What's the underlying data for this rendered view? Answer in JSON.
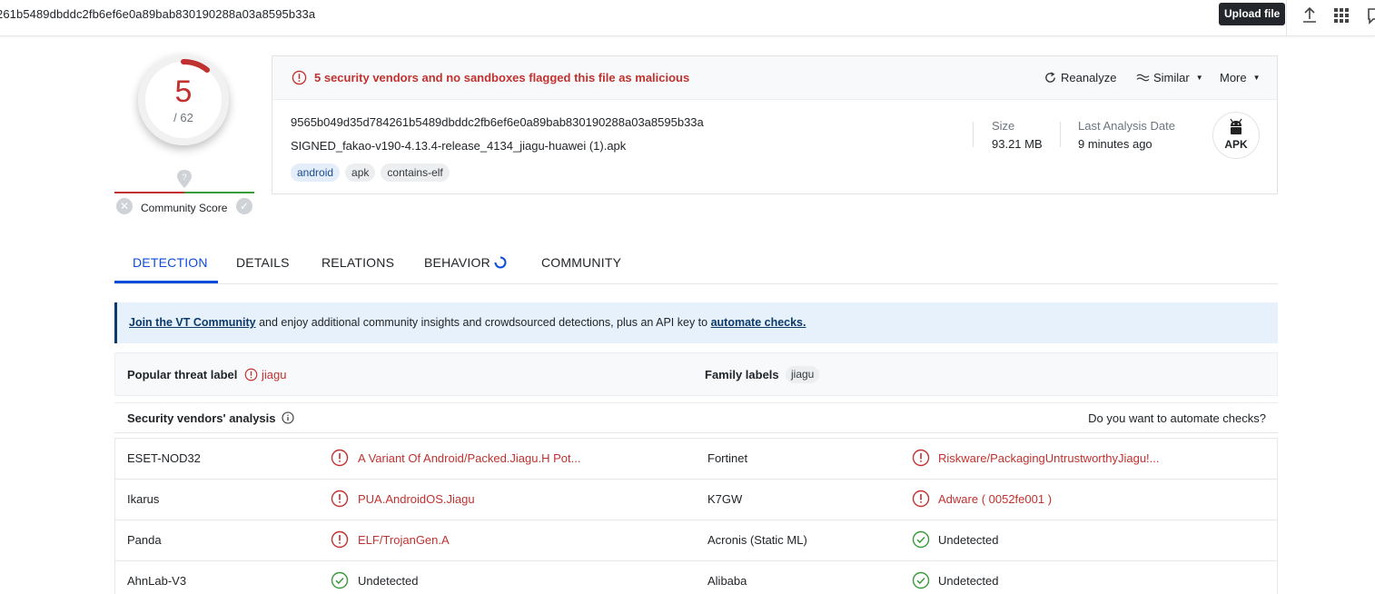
{
  "topbar": {
    "hash_text": "261b5489dbddc2fb6ef6e0a89bab830190288a03a8595b33a",
    "tooltip": "Upload file",
    "icons": [
      "upload-icon",
      "apps-grid-icon",
      "chat-icon"
    ]
  },
  "score": {
    "detections": "5",
    "total": "/ 62",
    "detection_fraction": 0.0806,
    "community_label": "Community Score"
  },
  "card": {
    "alert": "5 security vendors and no sandboxes flagged this file as malicious",
    "actions": {
      "reanalyze": "Reanalyze",
      "similar": "Similar",
      "more": "More"
    },
    "file_hash": "9565b049d35d784261b5489dbddc2fb6ef6e0a89bab830190288a03a8595b33a",
    "file_name": "SIGNED_fakao-v190-4.13.4-release_4134_jiagu-huawei (1).apk",
    "tags": [
      "android",
      "apk",
      "contains-elf"
    ],
    "size_label": "Size",
    "size_value": "93.21 MB",
    "date_label": "Last Analysis Date",
    "date_value": "9 minutes ago",
    "file_type": "APK"
  },
  "tabs": {
    "detection": "DETECTION",
    "details": "DETAILS",
    "relations": "RELATIONS",
    "behavior": "BEHAVIOR",
    "community": "COMMUNITY"
  },
  "banner": {
    "link1": "Join the VT Community",
    "middle": " and enjoy additional community insights and crowdsourced detections, plus an API key to ",
    "link2": "automate checks."
  },
  "threat": {
    "popular_label_title": "Popular threat label",
    "popular_label_value": "jiagu",
    "family_labels_title": "Family labels",
    "family_label_value": "jiagu"
  },
  "vendors_header": {
    "title": "Security vendors' analysis",
    "automate": "Do you want to automate checks?"
  },
  "vendors": [
    {
      "left_name": "ESET-NOD32",
      "left_result": "A Variant Of Android/Packed.Jiagu.H Pot...",
      "left_status": "malicious",
      "right_name": "Fortinet",
      "right_result": "Riskware/PackagingUntrustworthyJiagu!...",
      "right_status": "malicious"
    },
    {
      "left_name": "Ikarus",
      "left_result": "PUA.AndroidOS.Jiagu",
      "left_status": "malicious",
      "right_name": "K7GW",
      "right_result": "Adware ( 0052fe001 )",
      "right_status": "malicious"
    },
    {
      "left_name": "Panda",
      "left_result": "ELF/TrojanGen.A",
      "left_status": "malicious",
      "right_name": "Acronis (Static ML)",
      "right_result": "Undetected",
      "right_status": "undetected"
    },
    {
      "left_name": "AhnLab-V3",
      "left_result": "Undetected",
      "left_status": "undetected",
      "right_name": "Alibaba",
      "right_result": "Undetected",
      "right_status": "undetected"
    }
  ],
  "colors": {
    "malicious": "#c0322f",
    "clean": "#3a9a3a",
    "accent": "#0b4dda"
  }
}
